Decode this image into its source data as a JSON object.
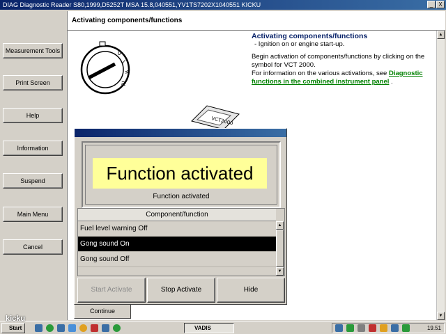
{
  "window": {
    "title": "DIAG Diagnostic Reader S80,1999,D5252T MSA 15.8,040551,YV1TS7202X1040551 KICKU",
    "minimize": "_",
    "close": "X"
  },
  "left_menu": {
    "items": [
      "Measurement Tools",
      "Print Screen",
      "Help",
      "Information",
      "Suspend",
      "Main Menu",
      "Cancel"
    ]
  },
  "main": {
    "heading": "Activating components/functions",
    "info_title": "Activating components/functions",
    "bullet": "-  Ignition on or engine start-up.",
    "para1": "Begin activation of components/functions by clicking on the symbol for VCT 2000.",
    "para2": "For information on the various activations, see ",
    "link": "Diagnostic functions in the combined instrument panel",
    "para2_end": " .",
    "device_label": "VCT2000",
    "continue": "Continue"
  },
  "dialog": {
    "status_big": "Function activated",
    "status_small": "Function activated",
    "list_header": "Component/function",
    "items": [
      {
        "label": "Fuel level warning Off",
        "selected": false
      },
      {
        "label": "Gong sound On",
        "selected": true
      },
      {
        "label": "Gong sound Off",
        "selected": false
      }
    ],
    "buttons": {
      "start": "Start Activate",
      "stop": "Stop Activate",
      "hide": "Hide"
    }
  },
  "taskbar": {
    "start": "Start",
    "active_task": "VADIS",
    "clock": "19.51"
  },
  "watermark": "kicku"
}
